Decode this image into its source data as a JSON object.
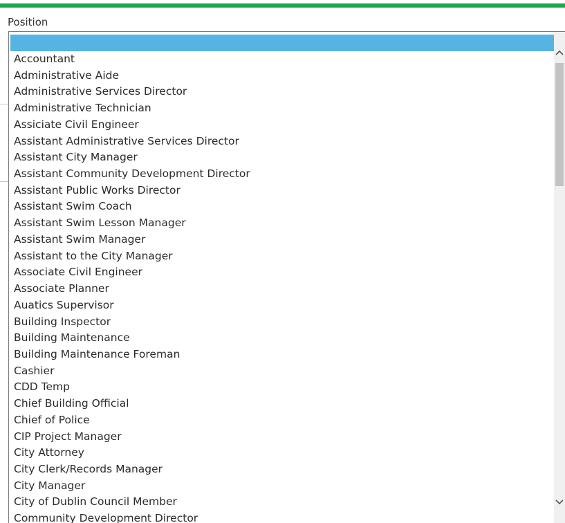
{
  "field": {
    "label": "Position",
    "selected_value": ""
  },
  "options": [
    "Accountant",
    "Administrative Aide",
    "Administrative Services Director",
    "Administrative Technician",
    "Assiciate Civil Engineer",
    "Assistant Administrative Services Director",
    "Assistant City Manager",
    "Assistant Community Development Director",
    "Assistant Public Works Director",
    "Assistant Swim Coach",
    "Assistant Swim Lesson Manager",
    "Assistant Swim Manager",
    "Assistant to the City Manager",
    "Associate Civil Engineer",
    "Associate Planner",
    "Auatics Supervisor",
    "Building Inspector",
    "Building Maintenance",
    "Building Maintenance Foreman",
    "Cashier",
    "CDD Temp",
    "Chief Building Official",
    "Chief of Police",
    "CIP Project Manager",
    "City Attorney",
    "City Clerk/Records Manager",
    "City Manager",
    "City of Dublin Council Member",
    "Community Development Director"
  ],
  "scroll": {
    "up_icon": "chevron-up-icon",
    "down_icon": "chevron-down-icon"
  },
  "colors": {
    "accent_bar": "#1aa84a",
    "selection": "#56b4e4"
  }
}
